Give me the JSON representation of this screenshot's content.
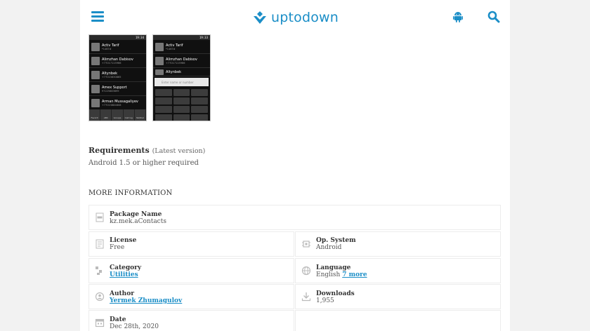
{
  "header": {
    "logo_text": "uptodown",
    "menu_icon": "hamburger-menu-icon",
    "android_icon": "android-icon",
    "search_icon": "search-icon",
    "brand_color": "#1b8ec7"
  },
  "screenshots": [
    {
      "status_time": "19:34",
      "contacts": [
        {
          "name": "Activ Tarif",
          "phone": "*1467#"
        },
        {
          "name": "Alimzhan Dabisov",
          "phone": "+77017115966"
        },
        {
          "name": "Altynbek",
          "phone": "+77015630865"
        },
        {
          "name": "Amex Support",
          "phone": "97225683699"
        },
        {
          "name": "Arman Mussagaliyev",
          "phone": "+77015884808"
        }
      ],
      "tabs": [
        "Favorit",
        "ABC",
        "Groups",
        "Call log",
        "Tel/Dial"
      ]
    },
    {
      "status_time": "19:33",
      "contacts": [
        {
          "name": "Activ Tarif",
          "phone": "*1467#"
        },
        {
          "name": "Alimzhan Dabisov",
          "phone": "+77017115966"
        },
        {
          "name": "Altynbek",
          "phone": ""
        }
      ],
      "entry_placeholder": "Enter name or number"
    }
  ],
  "requirements": {
    "title": "Requirements",
    "subtitle": "(Latest version)",
    "text": "Android 1.5 or higher required"
  },
  "more_info": {
    "title": "MORE INFORMATION",
    "package": {
      "label": "Package Name",
      "value": "kz.mek.aContacts",
      "icon": "package-icon"
    },
    "license": {
      "label": "License",
      "value": "Free",
      "icon": "license-icon"
    },
    "os": {
      "label": "Op. System",
      "value": "Android",
      "icon": "chip-icon"
    },
    "category": {
      "label": "Category",
      "value": "Utilities",
      "icon": "category-icon"
    },
    "language": {
      "label": "Language",
      "value": "English",
      "more": "7 more",
      "icon": "globe-icon"
    },
    "author": {
      "label": "Author",
      "value": "Yermek Zhumagulov",
      "icon": "author-icon"
    },
    "downloads": {
      "label": "Downloads",
      "value": "1,955",
      "icon": "download-icon"
    },
    "date": {
      "label": "Date",
      "value": "Dec 28th, 2020",
      "icon": "calendar-icon"
    }
  }
}
